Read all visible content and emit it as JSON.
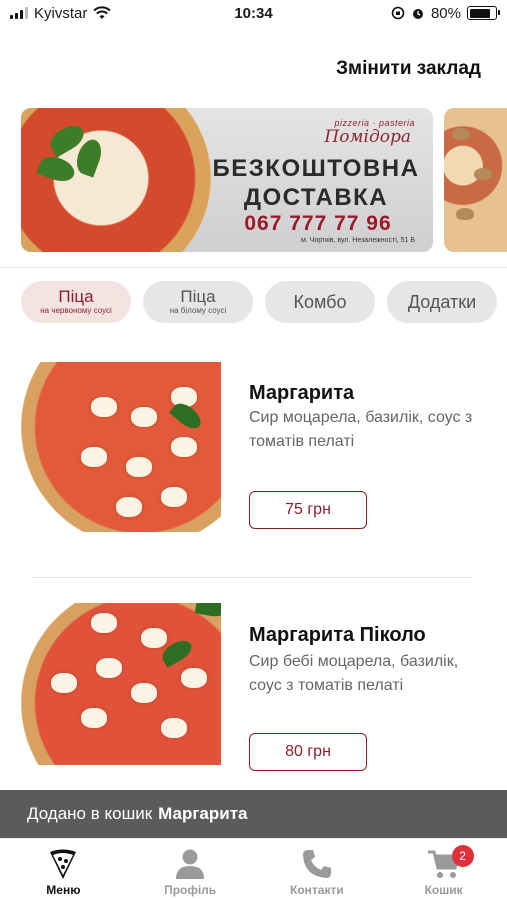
{
  "status_bar": {
    "carrier": "Kyivstar",
    "time": "10:34",
    "battery": "80%",
    "battery_level": 0.8
  },
  "header": {
    "change_venue": "Змінити заклад"
  },
  "banner": {
    "brand_small": "pizzeria · pasteria",
    "brand": "Помідора",
    "title_line1": "БЕЗКОШТОВНА",
    "title_line2": "ДОСТАВКА",
    "phone": "067 777 77 96",
    "address": "м. Чортків, вул. Незалежності, 51 Б"
  },
  "categories": [
    {
      "title": "Піца",
      "subtitle": "на червоному соусі",
      "active": true
    },
    {
      "title": "Піца",
      "subtitle": "на білому соусі",
      "active": false
    },
    {
      "title": "Комбо",
      "subtitle": "",
      "active": false
    },
    {
      "title": "Додатки",
      "subtitle": "",
      "active": false
    }
  ],
  "products": [
    {
      "name": "Маргарита",
      "description": "Сир моцарела, базилік, соус з томатів пелаті",
      "price": "75 грн"
    },
    {
      "name": "Маргарита Піколо",
      "description": "Сир бебі моцарела, базилік, соус з томатів пелаті",
      "price": "80 грн"
    }
  ],
  "toast": {
    "prefix": "Додано в кошик",
    "item": "Маргарита"
  },
  "tabbar": {
    "items": [
      {
        "label": "Меню",
        "icon": "pizza-slice-icon",
        "active": true
      },
      {
        "label": "Профіль",
        "icon": "person-icon",
        "active": false
      },
      {
        "label": "Контакти",
        "icon": "phone-icon",
        "active": false
      },
      {
        "label": "Кошик",
        "icon": "cart-icon",
        "active": false
      }
    ],
    "cart_count": "2"
  },
  "colors": {
    "accent": "#8e1f2a",
    "toast_bg": "#5b5b5b",
    "badge": "#e0303a"
  }
}
